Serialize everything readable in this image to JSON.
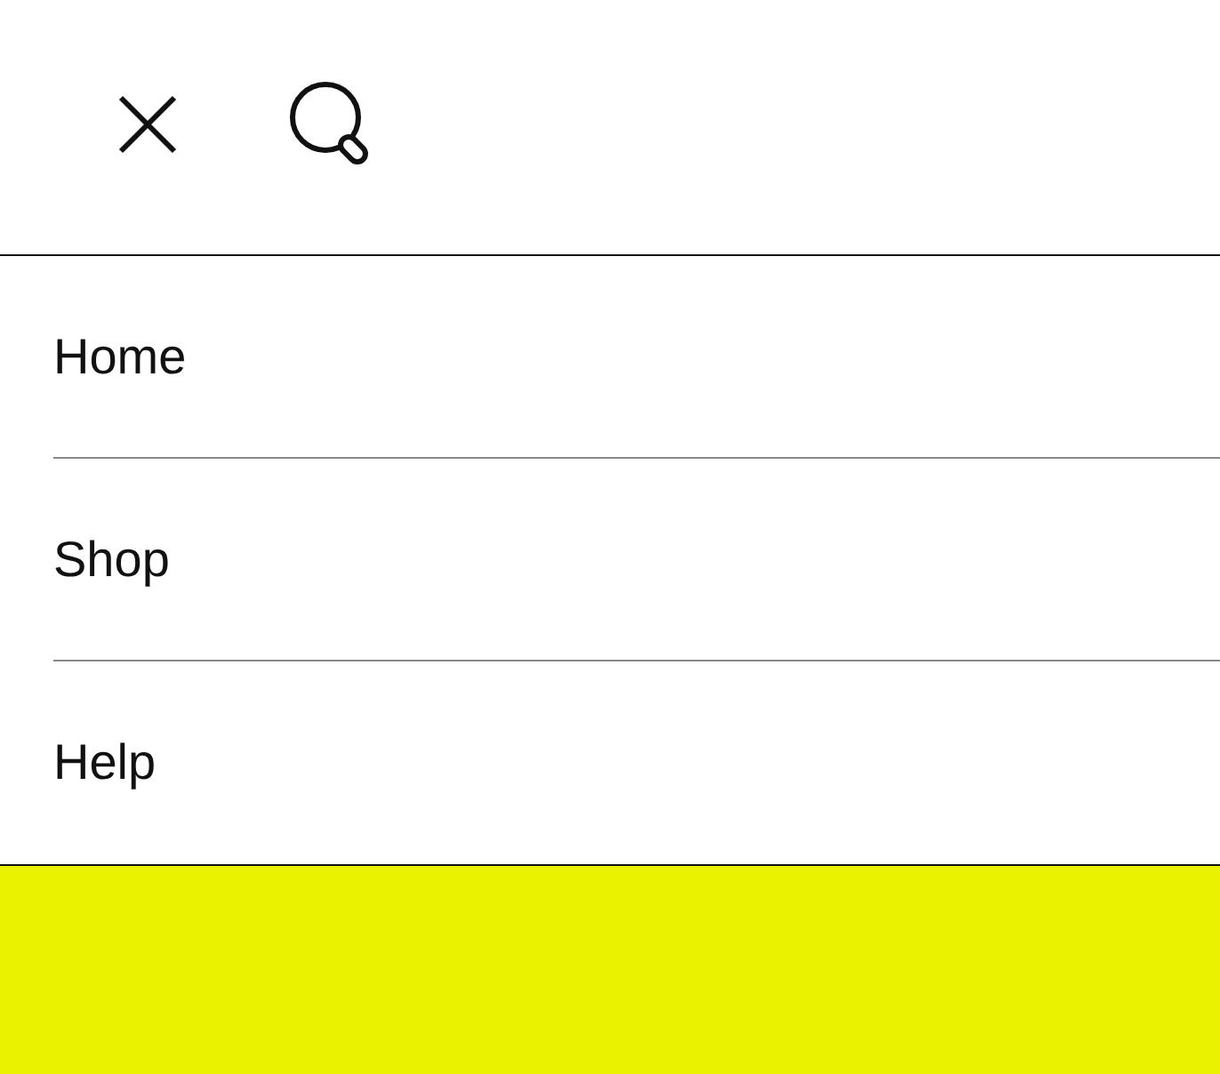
{
  "menu": {
    "items": [
      {
        "label": "Home"
      },
      {
        "label": "Shop"
      },
      {
        "label": "Help"
      }
    ]
  }
}
